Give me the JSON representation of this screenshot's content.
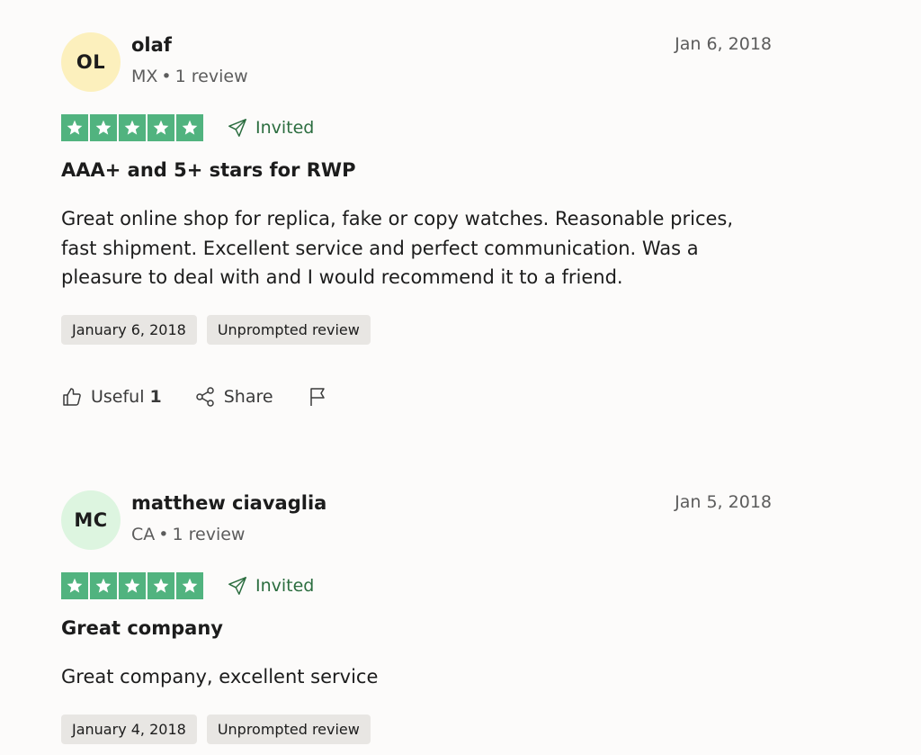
{
  "reviews": [
    {
      "initials": "OL",
      "avatar_color": "#fcf0bd",
      "name": "olaf",
      "country": "MX",
      "review_count": "1 review",
      "date": "Jan 6, 2018",
      "stars": 5,
      "invited_label": "Invited",
      "title": "AAA+ and 5+ stars for RWP",
      "body": [
        "Great online shop for replica, fake or copy watches. Reasonable prices,",
        "fast shipment. Excellent service and perfect communication. Was a",
        "pleasure to deal with and I would recommend it to a friend."
      ],
      "experience_date": "January 6, 2018",
      "review_type": "Unprompted review",
      "useful_label": "Useful",
      "useful_count": "1",
      "share_label": "Share"
    },
    {
      "initials": "MC",
      "avatar_color": "#ddf5e0",
      "name": "matthew ciavaglia",
      "country": "CA",
      "review_count": "1 review",
      "date": "Jan 5, 2018",
      "stars": 5,
      "invited_label": "Invited",
      "title": "Great company",
      "body": [
        "Great company, excellent service"
      ],
      "experience_date": "January 4, 2018",
      "review_type": "Unprompted review"
    }
  ],
  "colors": {
    "star_green": "#51b37f",
    "invited_green": "#2b6d3f"
  },
  "icons": {
    "star": "star-icon",
    "invited": "paper-plane-icon",
    "useful": "thumbs-up-icon",
    "share": "share-icon",
    "report": "flag-icon"
  }
}
